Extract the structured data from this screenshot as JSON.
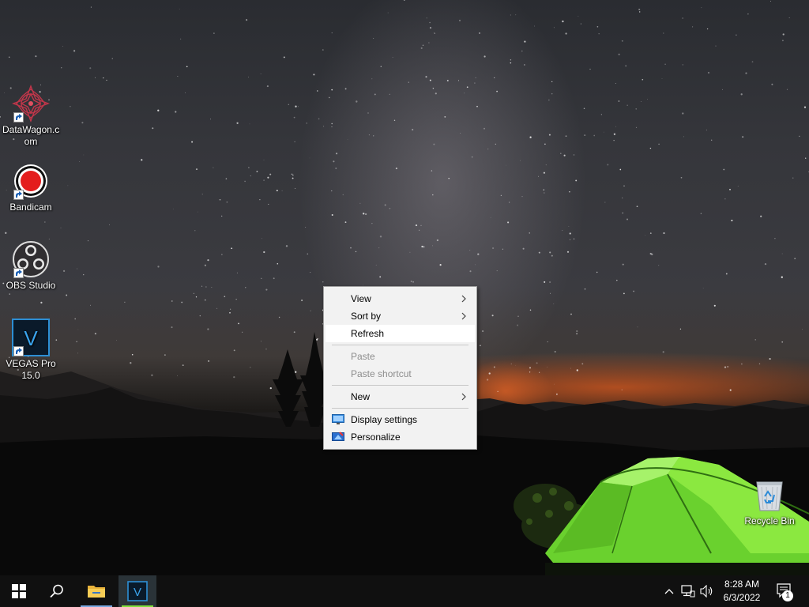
{
  "desktop": {
    "icons": [
      {
        "label": "DataWagon.com",
        "label_line1": "DataWagon.c",
        "label_line2": "om",
        "icon": "datawagon-logo-icon"
      },
      {
        "label": "Bandicam",
        "icon": "bandicam-record-icon"
      },
      {
        "label": "OBS Studio",
        "icon": "obs-studio-icon"
      },
      {
        "label_line1": "VEGAS Pro",
        "label_line2": "15.0",
        "icon": "vegas-pro-icon",
        "glyph": "V"
      },
      {
        "label": "Recycle Bin",
        "icon": "recycle-bin-icon"
      }
    ]
  },
  "context_menu": {
    "items": [
      {
        "label": "View",
        "has_submenu": true
      },
      {
        "label": "Sort by",
        "has_submenu": true
      },
      {
        "label": "Refresh",
        "highlighted": true
      },
      {
        "label": "Paste",
        "disabled": true
      },
      {
        "label": "Paste shortcut",
        "disabled": true
      },
      {
        "label": "New",
        "has_submenu": true
      },
      {
        "label": "Display settings",
        "icon": "display-settings-icon"
      },
      {
        "label": "Personalize",
        "icon": "personalize-icon"
      }
    ]
  },
  "taskbar": {
    "start_icon": "windows-start-icon",
    "search_icon": "search-icon",
    "pinned": [
      {
        "name": "File Explorer",
        "icon": "file-explorer-icon"
      },
      {
        "name": "VEGAS Pro",
        "icon": "vegas-pro-icon",
        "glyph": "V",
        "active": true
      }
    ],
    "tray": {
      "chevron_icon": "chevron-up-icon",
      "network_icon": "network-icon",
      "volume_icon": "volume-icon",
      "time": "8:28 AM",
      "date": "6/3/2022",
      "notification_icon": "action-center-icon",
      "notification_count": "1"
    }
  },
  "colors": {
    "taskbar": "#101010",
    "menu_bg": "#f2f2f2",
    "menu_highlight": "#ffffff",
    "disabled_text": "#8d8d8d",
    "tent_green": "#7ee03a",
    "accent_blue": "#78a8e0"
  }
}
